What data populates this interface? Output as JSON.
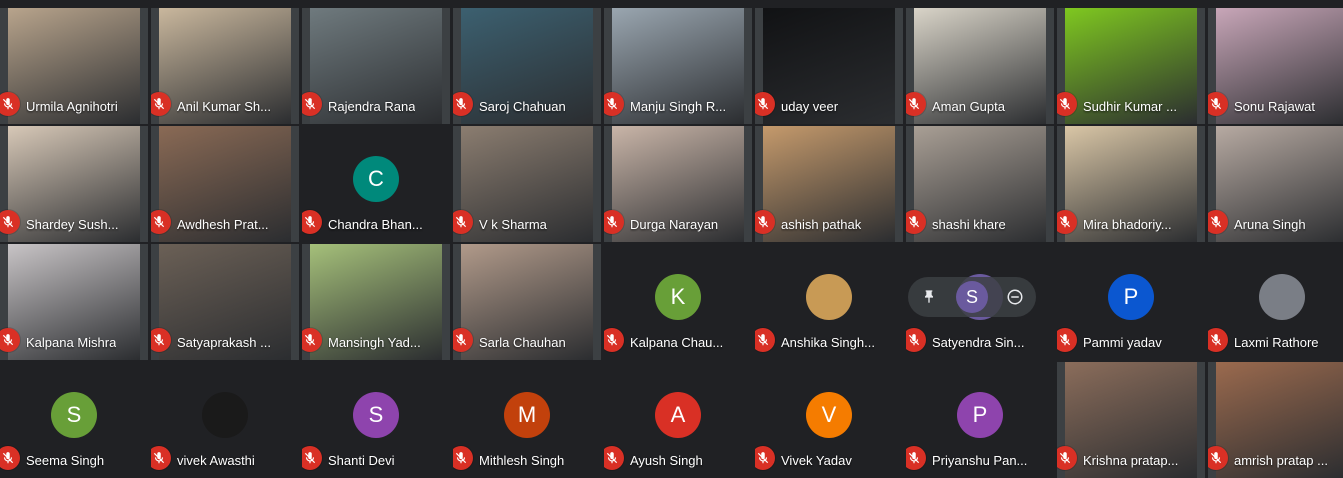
{
  "meeting": {
    "tiles": [
      {
        "name": "Urmila Agnihotri",
        "kind": "video",
        "bg": "#b8a48c"
      },
      {
        "name": "Anil Kumar Sh...",
        "kind": "video",
        "bg": "#c9b79d"
      },
      {
        "name": "Rajendra Rana",
        "kind": "video",
        "bg": "#6f7a7e"
      },
      {
        "name": "Saroj Chahuan",
        "kind": "video",
        "bg": "#3c6070"
      },
      {
        "name": "Manju Singh R...",
        "kind": "video",
        "bg": "#9aa6b0"
      },
      {
        "name": "uday veer",
        "kind": "video",
        "bg": "#111214"
      },
      {
        "name": "Aman Gupta",
        "kind": "video",
        "bg": "#d9d4c8"
      },
      {
        "name": "Sudhir Kumar ...",
        "kind": "video",
        "bg": "#7fc820"
      },
      {
        "name": "Sonu Rajawat",
        "kind": "video",
        "bg": "#c8a6b8"
      },
      {
        "name": "Shardey Sush...",
        "kind": "video",
        "bg": "#d7c8b7"
      },
      {
        "name": "Awdhesh Prat...",
        "kind": "video",
        "bg": "#8a6a55"
      },
      {
        "name": "Chandra Bhan...",
        "kind": "avatar",
        "initial": "C",
        "avatar_color": "#00897b"
      },
      {
        "name": "V k Sharma",
        "kind": "video",
        "bg": "#8b7d70"
      },
      {
        "name": "Durga Narayan",
        "kind": "video",
        "bg": "#c9b5a8"
      },
      {
        "name": "ashish pathak",
        "kind": "video",
        "bg": "#c59a6c"
      },
      {
        "name": "shashi khare",
        "kind": "video",
        "bg": "#a99f95"
      },
      {
        "name": "Mira bhadoriy...",
        "kind": "video",
        "bg": "#d9c6a6"
      },
      {
        "name": "Aruna Singh",
        "kind": "video",
        "bg": "#b7aaa2"
      },
      {
        "name": "Kalpana Mishra",
        "kind": "video",
        "bg": "#c8c4c6"
      },
      {
        "name": "Satyaprakash ...",
        "kind": "video",
        "bg": "#6b6056"
      },
      {
        "name": "Mansingh Yad...",
        "kind": "video",
        "bg": "#a5c07a"
      },
      {
        "name": "Sarla Chauhan",
        "kind": "video",
        "bg": "#b19a8a"
      },
      {
        "name": "Kalpana Chau...",
        "kind": "avatar",
        "initial": "K",
        "avatar_color": "#689f38"
      },
      {
        "name": "Anshika Singh...",
        "kind": "avatar",
        "initial": "",
        "avatar_color": "#c89a55"
      },
      {
        "name": "Satyendra Sin...",
        "kind": "avatar",
        "initial": "S",
        "avatar_color": "#6a5a9e",
        "hover": true
      },
      {
        "name": "Pammi yadav",
        "kind": "avatar",
        "initial": "P",
        "avatar_color": "#0b57d0"
      },
      {
        "name": "Laxmi Rathore",
        "kind": "avatar",
        "initial": "",
        "avatar_color": "#7a7e86"
      },
      {
        "name": "Seema Singh",
        "kind": "avatar",
        "initial": "S",
        "avatar_color": "#689f38"
      },
      {
        "name": "vivek Awasthi",
        "kind": "avatar",
        "initial": "",
        "avatar_color": "#1a1a1a"
      },
      {
        "name": "Shanti Devi",
        "kind": "avatar",
        "initial": "S",
        "avatar_color": "#8e44ad"
      },
      {
        "name": "Mithlesh Singh",
        "kind": "avatar",
        "initial": "M",
        "avatar_color": "#c2410c"
      },
      {
        "name": "Ayush Singh",
        "kind": "avatar",
        "initial": "A",
        "avatar_color": "#d93025"
      },
      {
        "name": "Vivek Yadav",
        "kind": "avatar",
        "initial": "V",
        "avatar_color": "#f57c00"
      },
      {
        "name": "Priyanshu Pan...",
        "kind": "avatar",
        "initial": "P",
        "avatar_color": "#8e44ad"
      },
      {
        "name": "Krishna pratap...",
        "kind": "video",
        "bg": "#8b6d5b"
      },
      {
        "name": "amrish pratap ...",
        "kind": "video",
        "bg": "#9b6a4e"
      }
    ]
  },
  "icons": {
    "muted": "mic-off-icon",
    "pin": "pin-icon",
    "remove": "remove-icon"
  }
}
